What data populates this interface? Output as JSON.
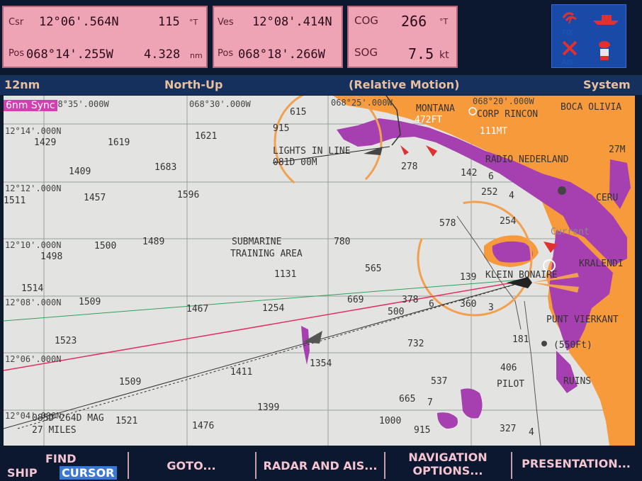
{
  "top": {
    "course": {
      "label": "Csr",
      "lat": "12°06'.564N",
      "bearing": "115",
      "bearing_unit": "°T"
    },
    "position": {
      "label": "Pos",
      "lon": "068°14'.255W",
      "distance": "4.328",
      "distance_unit": "nm"
    },
    "vessel": {
      "label": "Ves",
      "lat": "12°08'.414N",
      "pos_label": "Pos",
      "lon": "068°18'.266W"
    },
    "cog": {
      "label": "COG",
      "value": "266",
      "unit": "°T"
    },
    "sog": {
      "label": "SOG",
      "value": "7.5",
      "unit": "kt"
    },
    "icons": {
      "fix_label": "FIX",
      "ais_label": "AIS"
    }
  },
  "titlebar": {
    "range": "12nm",
    "orientation": "North-Up",
    "motion": "(Relative Motion)",
    "mode": "System"
  },
  "chart": {
    "sync_label": "6nm Sync",
    "lon_labels": [
      "068°35'.000W",
      "068°30'.000W",
      "068°25'.000W",
      "068°20'.000W"
    ],
    "lat_labels": [
      "12°14'.000N",
      "12°12'.000N",
      "12°10'.000N",
      "12°08'.000N",
      "12°06'.000N",
      "12°04'.000N"
    ],
    "depths": [
      "615",
      "915",
      "1429",
      "1619",
      "1621",
      "1409",
      "1683",
      "1511",
      "1457",
      "1596",
      "278",
      "142",
      "6",
      "252",
      "4",
      "578",
      "254",
      "1498",
      "1500",
      "1489",
      "780",
      "565",
      "1131",
      "139",
      "1514",
      "1509",
      "1467",
      "1254",
      "669",
      "378",
      "6",
      "500",
      "360",
      "3",
      "1523",
      "732",
      "181",
      "1354",
      "1411",
      "1509",
      "406",
      "537",
      "1399",
      "665",
      "7",
      "1521",
      "1476",
      "1000",
      "915",
      "327",
      "4"
    ],
    "places": {
      "lights": "LIGHTS IN LINE",
      "lights_bearing": "081D 00M",
      "montana": "MONTANA",
      "montana_height": "472FT",
      "corp_rincon": "CORP RINCON",
      "boca_olivia": "BOCA OLIVIA",
      "radio": "RADIO NEDERLAND",
      "height_111": "111MT",
      "submarine": "SUBMARINE",
      "training": "TRAINING AREA",
      "klein": "KLEIN BONAIRE",
      "kralendijk": "KRALENDI",
      "punt": "PUNT VIERKANT",
      "height_550": "(550Ft)",
      "pilot": "PILOT",
      "ruins": "RUINS",
      "ceru": "CERU",
      "current": "Current",
      "range_27": "27M",
      "mag_bearing": "085D 264D MAG",
      "miles": "27 MILES"
    }
  },
  "softkeys": {
    "ship": "SHIP",
    "find": "FIND",
    "cursor": "CURSOR",
    "goto": "GOTO...",
    "radar": "RADAR AND AIS...",
    "nav1": "NAVIGATION",
    "nav2": "OPTIONS...",
    "presentation": "PRESENTATION..."
  },
  "colors": {
    "land": "#f79a3c",
    "radar": "#a640b0",
    "pink_box": "#efa4b6",
    "title_bg": "#15305c",
    "chart_bg": "#e3e4e2"
  }
}
